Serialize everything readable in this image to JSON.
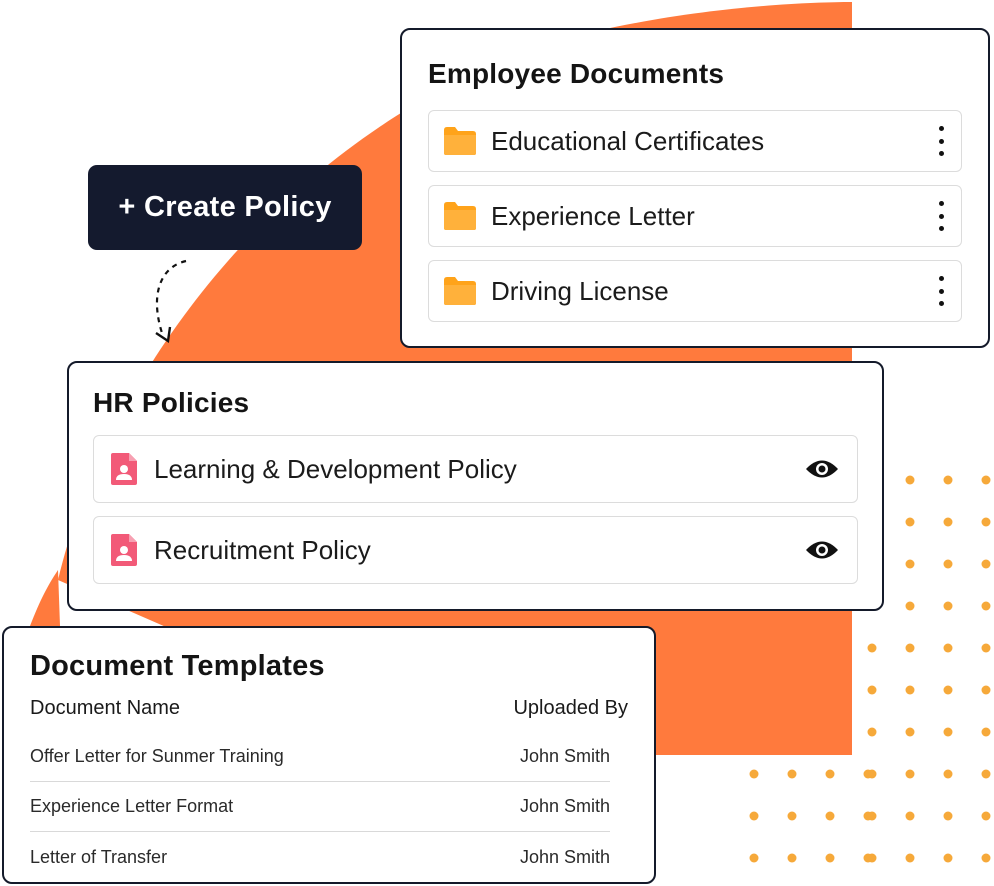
{
  "colors": {
    "accent_orange": "#ff7a3d",
    "dot_orange": "#f6a93a",
    "folder_orange": "#ffa31a",
    "policy_pink": "#f25a78",
    "button_dark": "#141a2e"
  },
  "create_button": {
    "label": "+ Create Policy"
  },
  "employee_documents": {
    "title": "Employee Documents",
    "items": [
      {
        "label": "Educational Certificates",
        "icon": "folder-icon"
      },
      {
        "label": "Experience Letter",
        "icon": "folder-icon"
      },
      {
        "label": "Driving License",
        "icon": "folder-icon"
      }
    ]
  },
  "hr_policies": {
    "title": "HR Policies",
    "items": [
      {
        "label": "Learning & Development Policy",
        "icon": "document-user-icon",
        "action_icon": "eye-icon"
      },
      {
        "label": "Recruitment Policy",
        "icon": "document-user-icon",
        "action_icon": "eye-icon"
      }
    ]
  },
  "document_templates": {
    "title": "Document Templates",
    "columns": [
      "Document Name",
      "Uploaded By"
    ],
    "rows": [
      {
        "name": "Offer Letter for Sunmer Training",
        "uploaded_by": "John Smith"
      },
      {
        "name": "Experience Letter Format",
        "uploaded_by": "John Smith"
      },
      {
        "name": "Letter of Transfer",
        "uploaded_by": "John Smith"
      }
    ]
  }
}
